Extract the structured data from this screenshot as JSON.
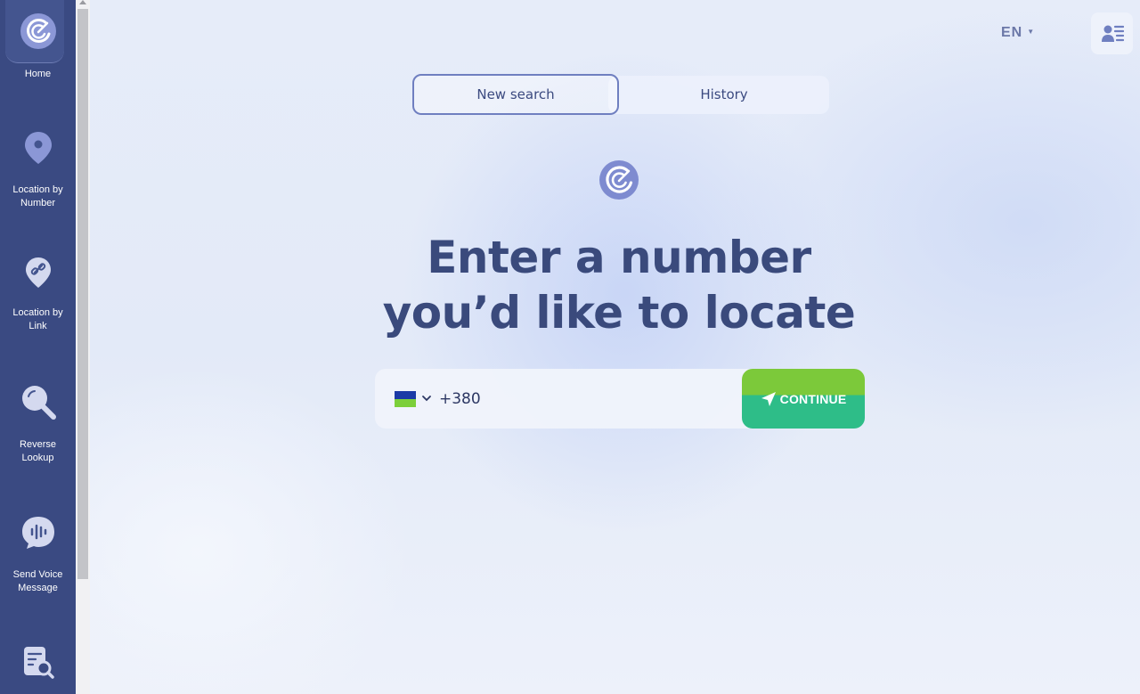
{
  "sidebar": {
    "items": [
      {
        "label": "Home",
        "icon": "radar-logo-icon"
      },
      {
        "label": "Location by Number",
        "icon": "map-pin-icon"
      },
      {
        "label": "Location by Link",
        "icon": "link-pin-icon"
      },
      {
        "label": "Reverse Lookup",
        "icon": "magnifier-icon"
      },
      {
        "label": "Send Voice Message",
        "icon": "voice-message-icon"
      },
      {
        "label": "",
        "icon": "document-search-icon"
      }
    ]
  },
  "header": {
    "language": "EN",
    "account_icon": "account-list-icon"
  },
  "tabs": [
    {
      "label": "New search",
      "active": true
    },
    {
      "label": "History",
      "active": false
    }
  ],
  "hero": {
    "title_line1": "Enter a number",
    "title_line2": "you’d like to locate"
  },
  "phone": {
    "country": "Ukraine",
    "value": "+380",
    "placeholder": ""
  },
  "continue_label": "CONTINUE",
  "colors": {
    "sidebar": "#3a4a82",
    "accent": "#3a4a7c",
    "button_top": "#7cc93a",
    "button_bottom": "#2ebd88"
  }
}
